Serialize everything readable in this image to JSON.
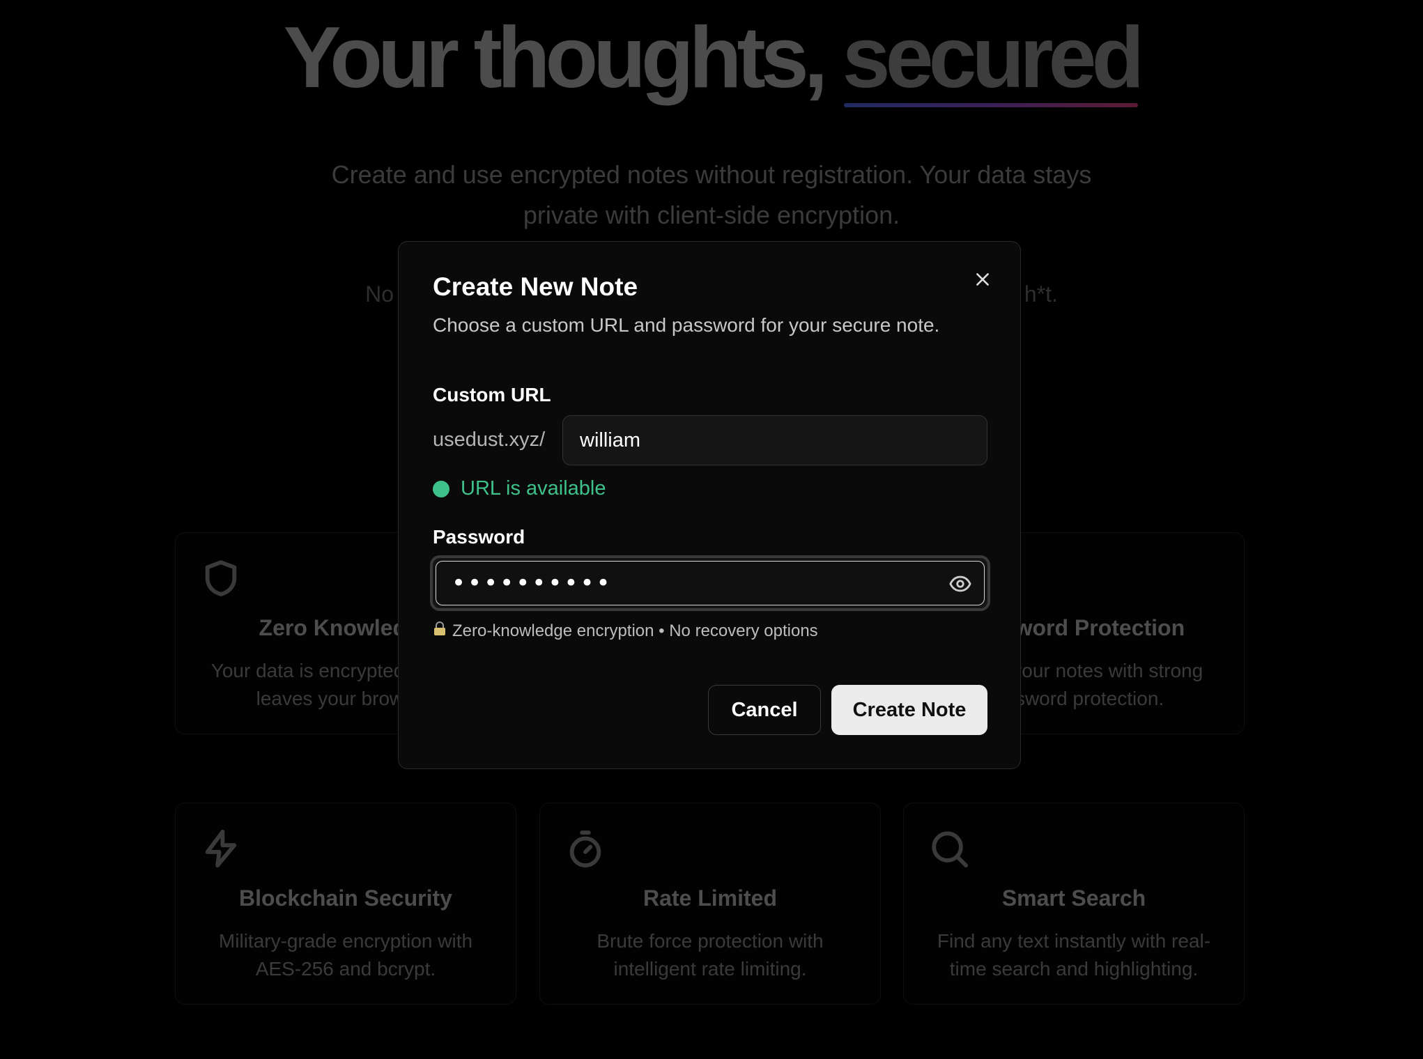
{
  "hero": {
    "title_main": "Your thoughts, ",
    "title_accent": "secured",
    "subtitle": "Create and use encrypted notes without registration. Your data stays private with client-side encryption.",
    "tagline_left": "No s",
    "tagline_right": "h*t."
  },
  "features": [
    {
      "icon": "shield-icon",
      "title": "Zero Knowledge",
      "desc": "Your data is encrypted before it leaves your browser."
    },
    {
      "icon": "",
      "title": "",
      "desc": ""
    },
    {
      "icon": "lock-icon",
      "title": "Password Protection",
      "desc": "Secure your notes with strong password protection."
    },
    {
      "icon": "zap-icon",
      "title": "Blockchain Security",
      "desc": "Military-grade encryption with AES-256 and bcrypt."
    },
    {
      "icon": "timer-icon",
      "title": "Rate Limited",
      "desc": "Brute force protection with intelligent rate limiting."
    },
    {
      "icon": "search-icon",
      "title": "Smart Search",
      "desc": "Find any text instantly with real-time search and highlighting."
    }
  ],
  "modal": {
    "title": "Create New Note",
    "description": "Choose a custom URL and password for your secure note.",
    "url_label": "Custom URL",
    "url_prefix": "usedust.xyz/",
    "url_value": "william",
    "url_status": "URL is available",
    "status_color": "#3ec28a",
    "password_label": "Password",
    "password_value": "••••••••••",
    "security_note": "Zero-knowledge encryption • No recovery options",
    "cancel_label": "Cancel",
    "create_label": "Create Note"
  }
}
